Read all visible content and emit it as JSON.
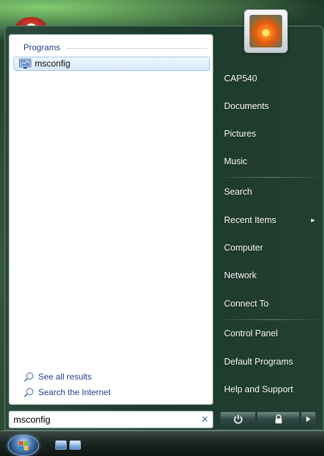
{
  "left_pane": {
    "programs_header": "Programs",
    "results": [
      {
        "label": "msconfig",
        "icon": "msconfig-app-icon"
      }
    ],
    "see_all_results": "See all results",
    "search_internet": "Search the Internet"
  },
  "search": {
    "value": "msconfig",
    "clear_symbol": "×"
  },
  "right_pane": {
    "items": [
      {
        "label": "CAP540"
      },
      {
        "label": "Documents"
      },
      {
        "label": "Pictures"
      },
      {
        "label": "Music"
      },
      {
        "label": "Search"
      },
      {
        "label": "Recent Items",
        "arrow": "►"
      },
      {
        "label": "Computer"
      },
      {
        "label": "Network"
      },
      {
        "label": "Connect To"
      },
      {
        "label": "Control Panel"
      },
      {
        "label": "Default Programs"
      },
      {
        "label": "Help and Support"
      }
    ]
  },
  "colors": {
    "link_blue": "#1e3f8a",
    "selection_border": "#9cc4e8",
    "menu_dark": "#1d3a2c"
  }
}
